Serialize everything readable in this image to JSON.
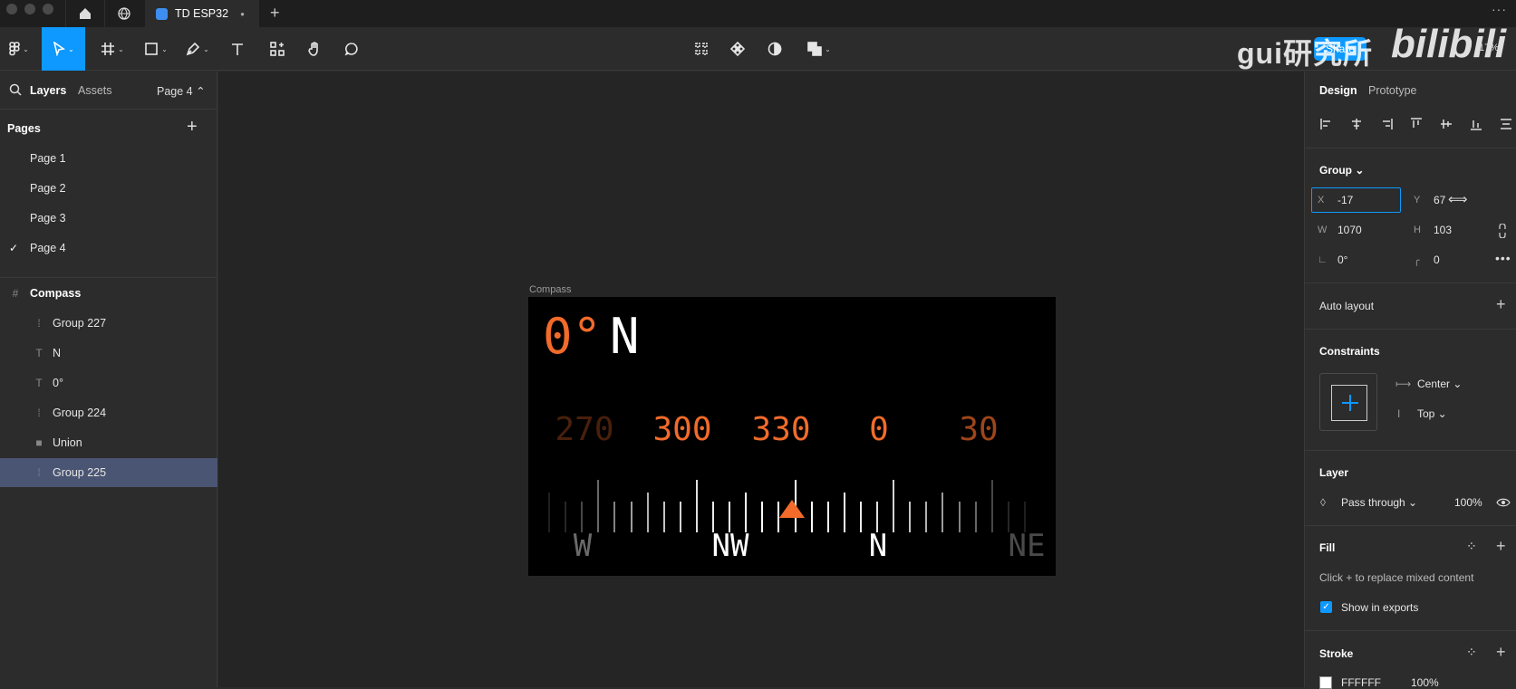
{
  "tabbar": {
    "file_tab": "TD ESP32",
    "file_dot": "●",
    "new_tab": "+",
    "more": "···"
  },
  "toolbar": {
    "share_label": "Share",
    "zoom": "17%",
    "watermark_text": "gui研究所",
    "watermark_logo": "bilibili"
  },
  "left_panel": {
    "tabs": {
      "layers": "Layers",
      "assets": "Assets",
      "page_selector": "Page 4 ⌃"
    },
    "pages_heading": "Pages",
    "pages_add": "+",
    "pages": [
      "Page 1",
      "Page 2",
      "Page 3",
      "Page 4"
    ],
    "current_page_check": "✓",
    "layers": [
      {
        "name": "Compass",
        "icon": "#"
      },
      {
        "name": "Group 227",
        "icon": "⁞"
      },
      {
        "name": "N",
        "icon": "T"
      },
      {
        "name": "0°",
        "icon": "T"
      },
      {
        "name": "Group 224",
        "icon": "⁞"
      },
      {
        "name": "Union",
        "icon": "■"
      },
      {
        "name": "Group 225",
        "icon": "⁞"
      }
    ]
  },
  "canvas": {
    "frame_label": "Compass",
    "compass": {
      "heading_degrees": "0°",
      "heading_direction": "N",
      "degree_labels": [
        "270",
        "300",
        "330",
        "0",
        "30"
      ],
      "cardinal_labels": [
        "W",
        "NW",
        "N",
        "NE"
      ],
      "accent_color": "#f26b2a"
    }
  },
  "right_panel": {
    "tabs": {
      "design": "Design",
      "prototype": "Prototype"
    },
    "group_heading": "Group ⌄",
    "x_label": "X",
    "x_value": "-17",
    "y_label": "Y",
    "y_value": "67",
    "w_label": "W",
    "w_value": "1070",
    "h_label": "H",
    "h_value": "103",
    "rotation": "0°",
    "radius": "0",
    "auto_layout": "Auto layout",
    "constraints_heading": "Constraints",
    "constraint_h": "Center ⌄",
    "constraint_v": "Top ⌄",
    "layer_heading": "Layer",
    "blend_mode": "Pass through ⌄",
    "opacity": "100%",
    "fill_heading": "Fill",
    "fill_hint": "Click + to replace mixed content",
    "show_in_exports": "Show in exports",
    "stroke_heading": "Stroke",
    "stroke_color": "FFFFFF",
    "stroke_opacity": "100%"
  }
}
